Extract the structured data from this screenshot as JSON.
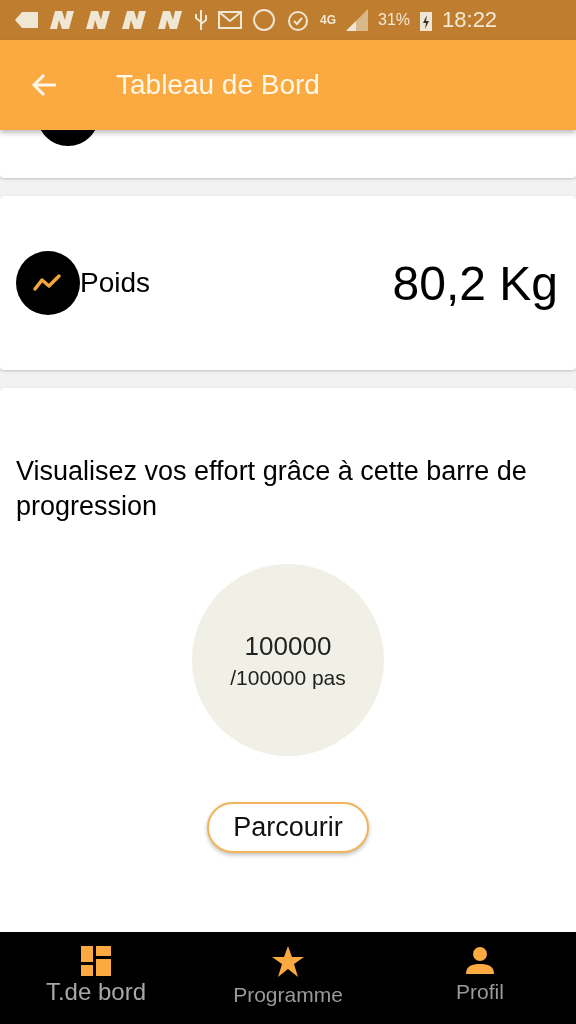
{
  "status_bar": {
    "network": "4G",
    "battery": "31%",
    "time": "18:22"
  },
  "app_bar": {
    "title": "Tableau de Bord"
  },
  "weight_card": {
    "label": "Poids",
    "value": "80,2 Kg"
  },
  "progress_card": {
    "text": "Visualisez vos effort grâce à cette barre de progression",
    "count": "100000",
    "goal": "/100000 pas",
    "button": "Parcourir"
  },
  "bottom_nav": [
    {
      "label": "T.de bord",
      "selected": true
    },
    {
      "label": "Programme",
      "selected": false
    },
    {
      "label": "Profil",
      "selected": false
    }
  ]
}
